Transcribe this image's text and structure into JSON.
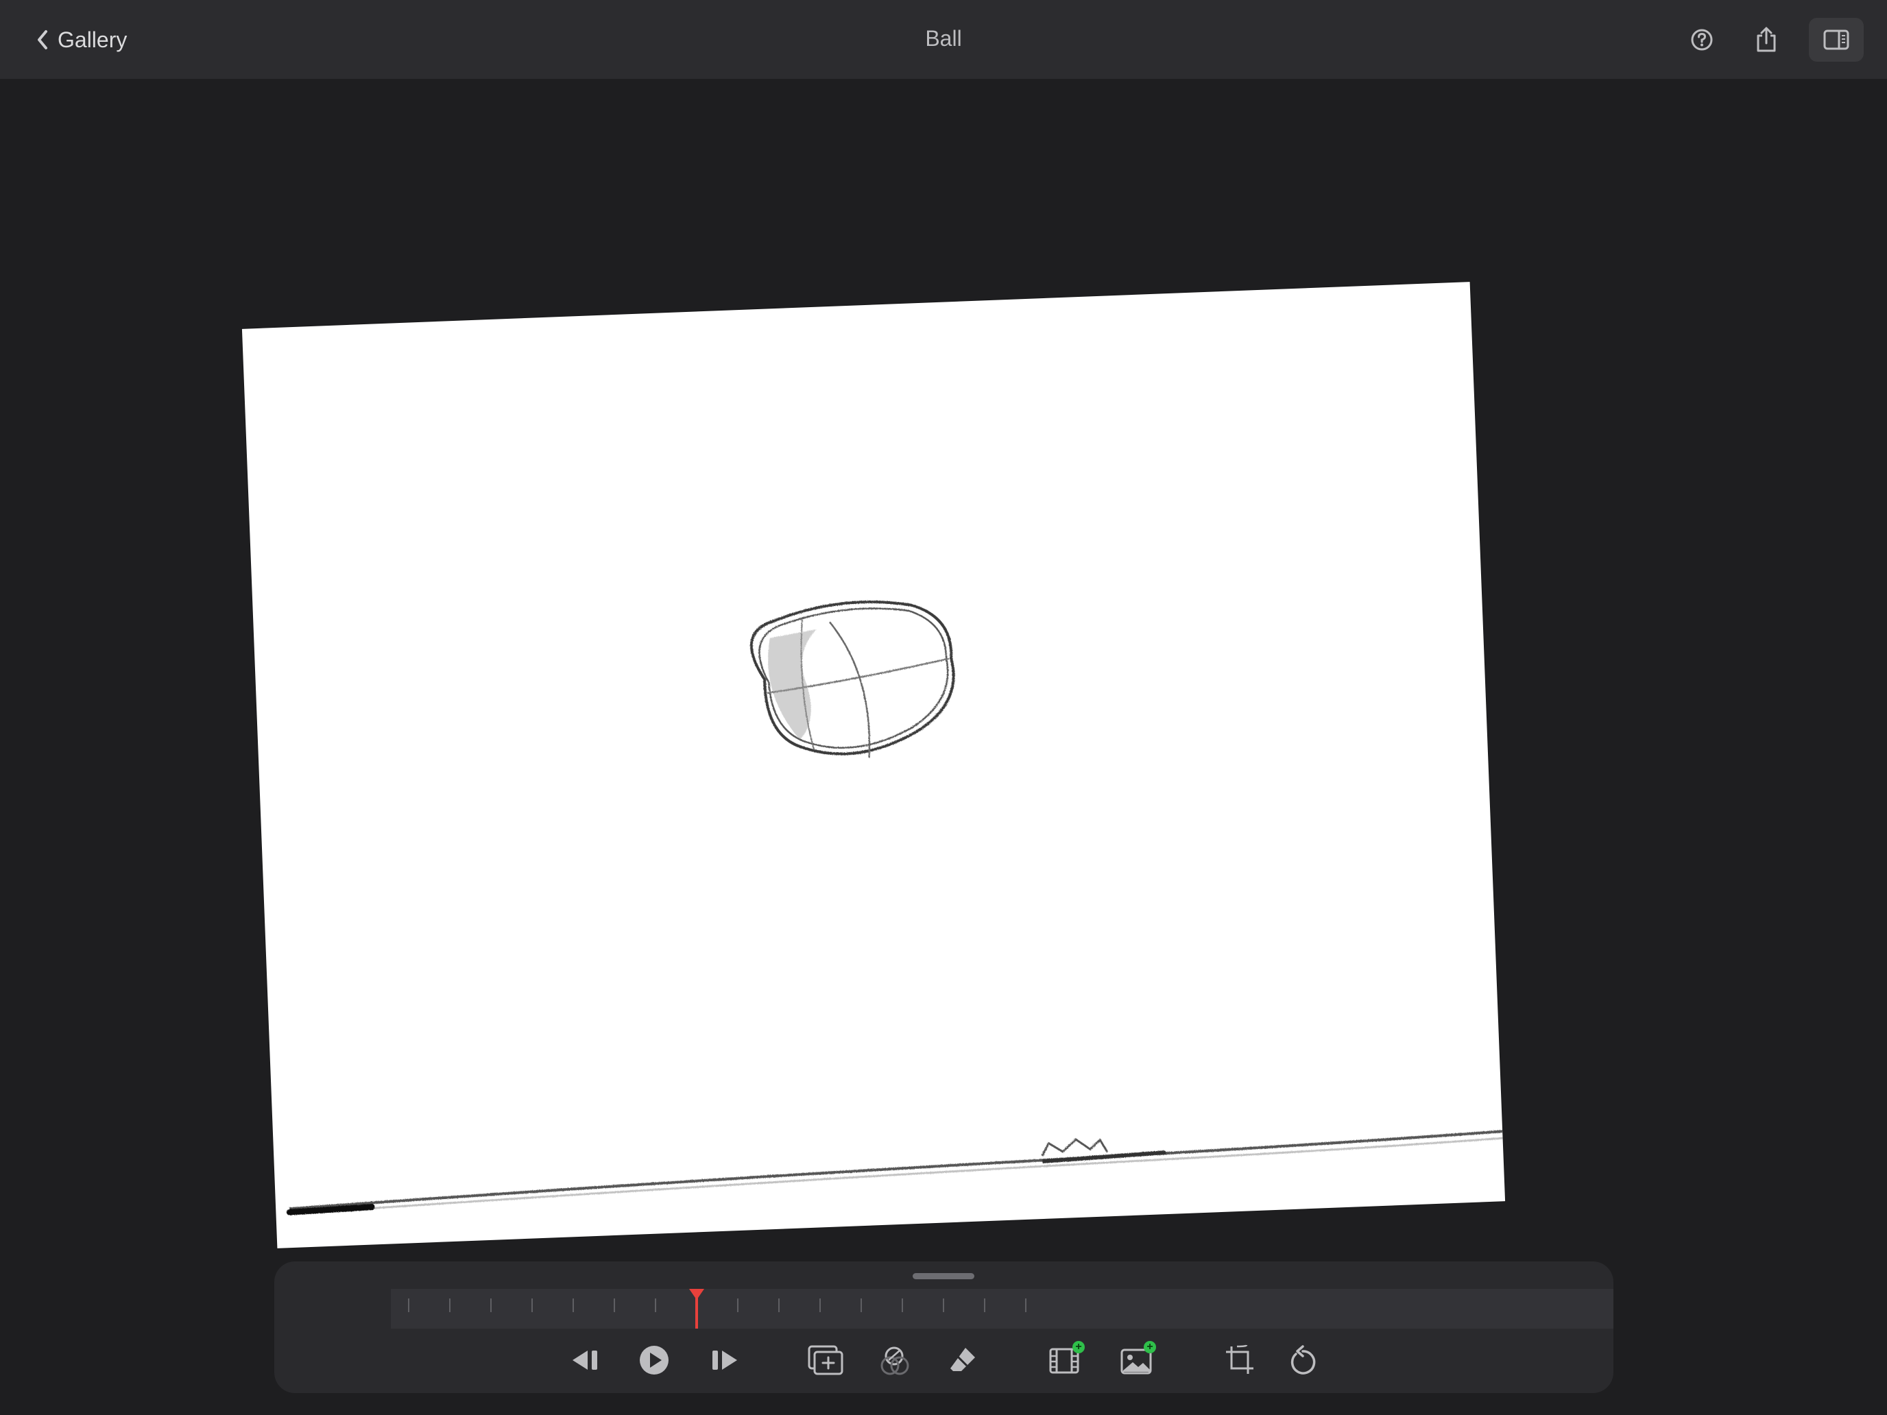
{
  "topbar": {
    "back_label": "Gallery",
    "title": "Ball",
    "icons": [
      "help-icon",
      "share-icon",
      "sidebar-toggle-icon"
    ]
  },
  "canvas": {
    "content": "pencil sketch of a ball above a ground line"
  },
  "timeline": {
    "tick_count": 16,
    "current_frame": 8
  },
  "toolbar": {
    "tools": [
      "previous-frame-icon",
      "play-icon",
      "next-frame-icon",
      "add-frame-icon",
      "onion-skin-icon",
      "eraser-icon",
      "add-video-icon",
      "add-image-icon",
      "crop-icon",
      "undo-icon"
    ],
    "badge_symbol": "+"
  },
  "colors": {
    "background": "#1e1e20",
    "topbar": "#2c2c2f",
    "dock": "#2a2a2d",
    "playhead": "#e8413c",
    "badge": "#2fbf4a",
    "icon": "#bdbdc0"
  }
}
